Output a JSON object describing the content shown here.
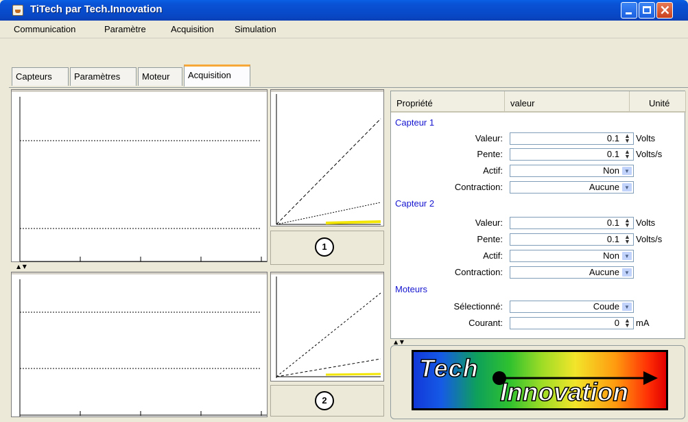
{
  "window": {
    "title": "TiTech par Tech.Innovation",
    "controls": {
      "minimize": "_",
      "maximize": "□",
      "close": "X"
    }
  },
  "menu": [
    "Communication",
    "Paramètre",
    "Acquisition",
    "Simulation"
  ],
  "tabs": [
    {
      "label": "Capteurs",
      "active": false
    },
    {
      "label": "Paramètres",
      "active": false
    },
    {
      "label": "Moteur",
      "active": false
    },
    {
      "label": "Acquisition",
      "active": true
    }
  ],
  "acquisition": {
    "plot_labels": [
      "1",
      "2"
    ]
  },
  "properties": {
    "headers": {
      "property": "Propriété",
      "value": "valeur",
      "unit": "Unité"
    },
    "sections": [
      {
        "title": "Capteur 1",
        "rows": [
          {
            "label": "Valeur:",
            "value": "0.1",
            "control": "spinner",
            "unit": "Volts"
          },
          {
            "label": "Pente:",
            "value": "0.1",
            "control": "spinner",
            "unit": "Volts/s"
          },
          {
            "label": "Actif:",
            "value": "Non",
            "control": "dropdown",
            "unit": ""
          },
          {
            "label": "Contraction:",
            "value": "Aucune",
            "control": "dropdown",
            "unit": ""
          }
        ]
      },
      {
        "title": "Capteur 2",
        "rows": [
          {
            "label": "Valeur:",
            "value": "0.1",
            "control": "spinner",
            "unit": "Volts"
          },
          {
            "label": "Pente:",
            "value": "0.1",
            "control": "spinner",
            "unit": "Volts/s"
          },
          {
            "label": "Actif:",
            "value": "Non",
            "control": "dropdown",
            "unit": ""
          },
          {
            "label": "Contraction:",
            "value": "Aucune",
            "control": "dropdown",
            "unit": ""
          }
        ]
      },
      {
        "title": "Moteurs",
        "rows": [
          {
            "label": "Sélectionné:",
            "value": "Coude",
            "control": "dropdown",
            "unit": ""
          },
          {
            "label": "Courant:",
            "value": "0",
            "control": "spinner",
            "unit": "mA"
          }
        ]
      }
    ]
  },
  "logo": {
    "line1": "Tech",
    "line2": "Innovation"
  },
  "colors": {
    "section_title": "#1515d0",
    "titlebar": "#0952d6",
    "active_tab_accent": "#f7a638",
    "plot_line": "#000000",
    "yellow_line": "#f2e500"
  }
}
